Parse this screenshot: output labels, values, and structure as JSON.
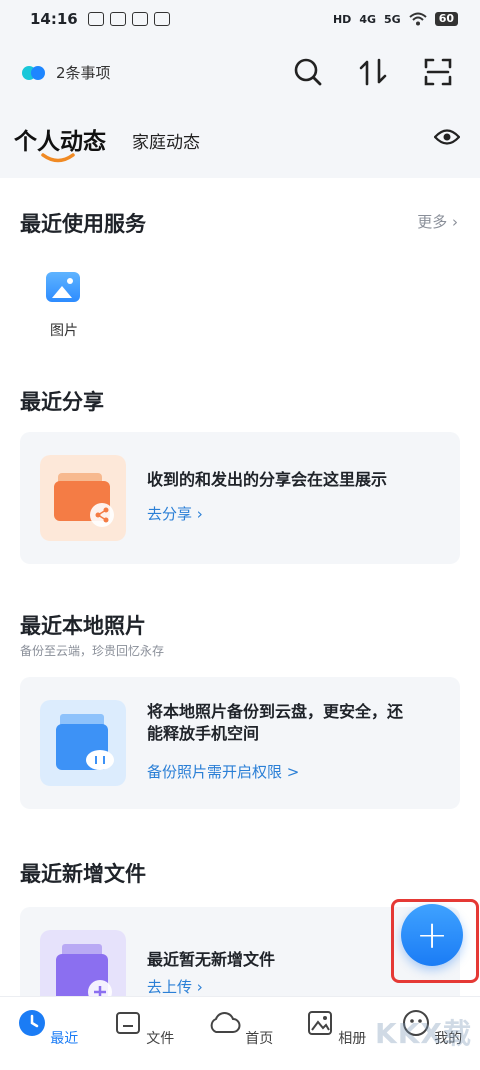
{
  "status_bar": {
    "time": "14:16",
    "battery": "60",
    "net_1": "4G",
    "net_2": "5G",
    "hd": "HD"
  },
  "header": {
    "todo_label": "2条事项",
    "tabs": [
      {
        "label": "个人动态",
        "active": true
      },
      {
        "label": "家庭动态",
        "active": false
      }
    ]
  },
  "recent_services": {
    "title": "最近使用服务",
    "more_label": "更多",
    "items": [
      {
        "label": "图片",
        "icon": "image-icon"
      }
    ]
  },
  "recent_share": {
    "title": "最近分享",
    "card_text": "收到的和发出的分享会在这里展示",
    "card_link": "去分享 ›"
  },
  "recent_local_photos": {
    "title": "最近本地照片",
    "subtitle": "备份至云端，珍贵回忆永存",
    "card_text_line1": "将本地照片备份到云盘，更安全，还",
    "card_text_line2": "能释放手机空间",
    "card_link": "备份照片需开启权限 >"
  },
  "recent_new_files": {
    "title": "最近新增文件",
    "card_text": "最近暂无新增文件",
    "card_link": "去上传 ›"
  },
  "fab": {
    "label": "+"
  },
  "tab_bar": {
    "items": [
      {
        "label": "最近",
        "icon": "clock-icon",
        "active": true
      },
      {
        "label": "文件",
        "icon": "folder-icon",
        "active": false
      },
      {
        "label": "首页",
        "icon": "cloud-icon",
        "active": false
      },
      {
        "label": "相册",
        "icon": "photo-album-icon",
        "active": false
      },
      {
        "label": "我的",
        "icon": "profile-icon",
        "active": false
      }
    ]
  },
  "watermark": "KKX载",
  "colors": {
    "accent": "#1b7cf5",
    "card_bg": "#f4f6f9",
    "link": "#2a7fd6",
    "highlight": "#e53935"
  }
}
